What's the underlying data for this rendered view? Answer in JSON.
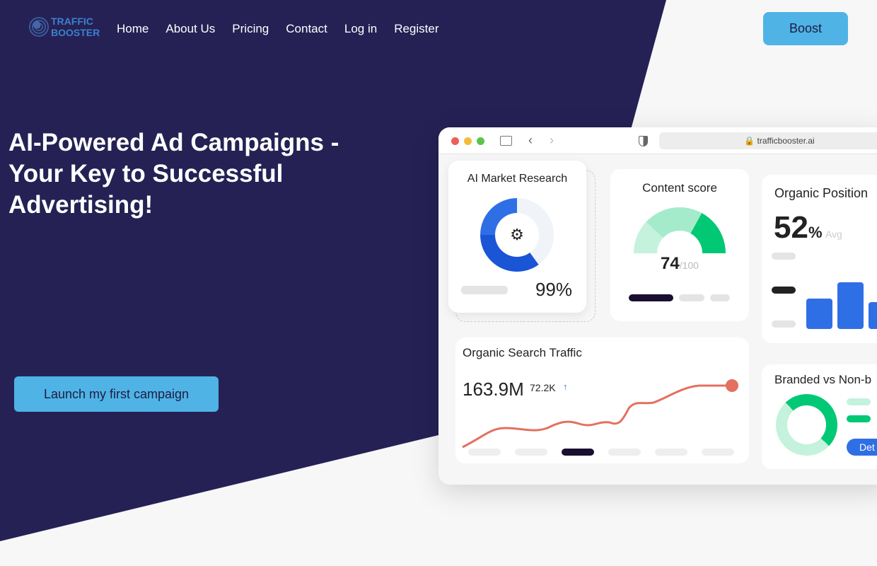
{
  "logo": {
    "line1": "TRAFFIC",
    "line2": "BOOSTER"
  },
  "nav": [
    "Home",
    "About Us",
    "Pricing",
    "Contact",
    "Log in",
    "Register"
  ],
  "boost_label": "Boost",
  "hero": {
    "title": "AI-Powered Ad Campaigns - Your Key to Successful Advertising!",
    "cta": "Launch my first campaign"
  },
  "dashboard": {
    "url": "trafficbooster.ai",
    "market": {
      "title": "AI Market Research",
      "value": "99%"
    },
    "content": {
      "title": "Content score",
      "value": "74",
      "max": "/100"
    },
    "position": {
      "title": "Organic Position",
      "value": "52",
      "unit": "%",
      "note": "Avg"
    },
    "traffic": {
      "title": "Organic Search Traffic",
      "value": "163.9M",
      "delta": "72.2K",
      "arrow": "↑"
    },
    "branded": {
      "title": "Branded vs Non-b",
      "button": "Det"
    }
  },
  "colors": {
    "navy": "#252154",
    "accent": "#4fb3e5",
    "blue": "#2f6fe6",
    "green": "#00c875",
    "line": "#e4705f"
  }
}
